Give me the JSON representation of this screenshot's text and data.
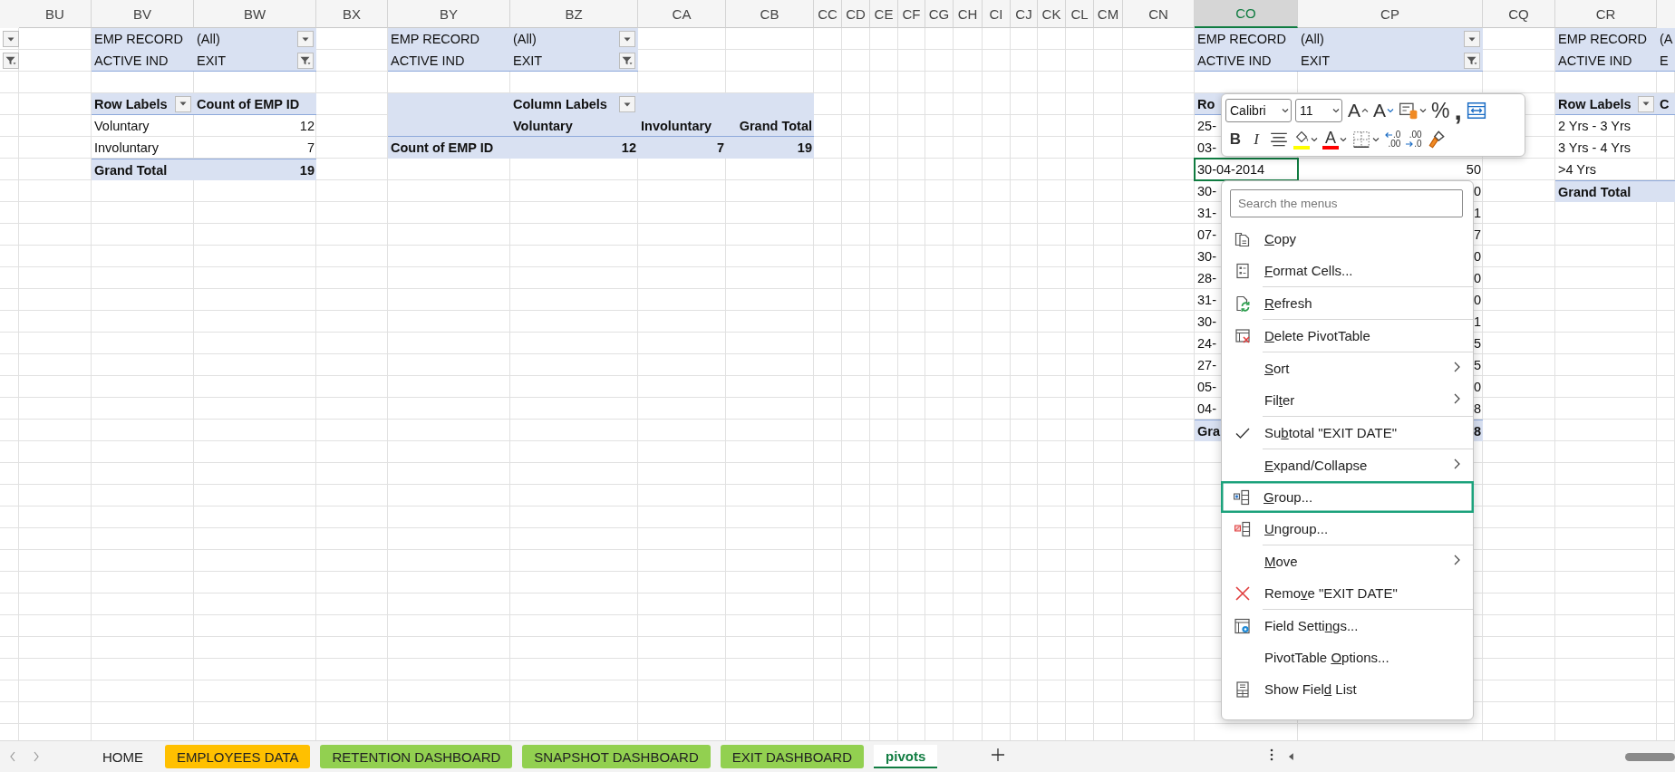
{
  "columns": [
    {
      "label": "BU",
      "selected": false
    },
    {
      "label": "BV",
      "selected": false
    },
    {
      "label": "BW",
      "selected": false
    },
    {
      "label": "BX",
      "selected": false
    },
    {
      "label": "BY",
      "selected": false
    },
    {
      "label": "BZ",
      "selected": false
    },
    {
      "label": "CA",
      "selected": false
    },
    {
      "label": "CB",
      "selected": false
    },
    {
      "label": "CC",
      "selected": false
    },
    {
      "label": "CD",
      "selected": false
    },
    {
      "label": "CE",
      "selected": false
    },
    {
      "label": "CF",
      "selected": false
    },
    {
      "label": "CG",
      "selected": false
    },
    {
      "label": "CH",
      "selected": false
    },
    {
      "label": "CI",
      "selected": false
    },
    {
      "label": "CJ",
      "selected": false
    },
    {
      "label": "CK",
      "selected": false
    },
    {
      "label": "CL",
      "selected": false
    },
    {
      "label": "CM",
      "selected": false
    },
    {
      "label": "CN",
      "selected": false
    },
    {
      "label": "CO",
      "selected": true
    },
    {
      "label": "CP",
      "selected": false
    },
    {
      "label": "CQ",
      "selected": false
    },
    {
      "label": "CR",
      "selected": false
    }
  ],
  "pivots": [
    {
      "kind": "stub",
      "filter_buttons": [
        {
          "filtered": false
        },
        {
          "filtered": true
        }
      ]
    },
    {
      "kind": "rows",
      "filters": [
        {
          "field": "EMP RECORD",
          "value": "(All)",
          "filtered": false
        },
        {
          "field": "ACTIVE IND",
          "value": "EXIT",
          "filtered": true
        }
      ],
      "header": [
        "Row Labels",
        "Count of EMP ID"
      ],
      "header_button": true,
      "rows": [
        {
          "cells": [
            "Voluntary",
            "12"
          ],
          "selected": false
        },
        {
          "cells": [
            "Involuntary",
            "7"
          ],
          "selected": false
        }
      ],
      "total": [
        "Grand Total",
        "19"
      ]
    },
    {
      "kind": "columns",
      "filters": [
        {
          "field": "EMP RECORD",
          "value": "(All)",
          "filtered": false
        },
        {
          "field": "ACTIVE IND",
          "value": "EXIT",
          "filtered": true
        }
      ],
      "column_labels": "Column Labels",
      "header_button": true,
      "columns": [
        "Voluntary",
        "Involuntary",
        "Grand Total"
      ],
      "rows": [
        {
          "label": "Count of EMP ID",
          "values": [
            "12",
            "7",
            "19"
          ],
          "selected": false
        }
      ]
    },
    {
      "kind": "rows",
      "filters": [
        {
          "field": "EMP RECORD",
          "value": "(All)",
          "filtered": false
        },
        {
          "field": "ACTIVE IND",
          "value": "EXIT",
          "filtered": true
        }
      ],
      "header": [
        "Ro"
      ],
      "header_button": false,
      "rows": [
        {
          "cells": [
            "25-"
          ],
          "selected": false
        },
        {
          "cells": [
            "03-"
          ],
          "selected": false
        },
        {
          "cells": [
            "30-04-2014",
            "50"
          ],
          "selected": true
        },
        {
          "cells": [
            "30-",
            "0"
          ],
          "selected": false
        },
        {
          "cells": [
            "31-",
            "1"
          ],
          "selected": false
        },
        {
          "cells": [
            "07-",
            "7"
          ],
          "selected": false
        },
        {
          "cells": [
            "30-",
            "0"
          ],
          "selected": false
        },
        {
          "cells": [
            "28-",
            "0"
          ],
          "selected": false
        },
        {
          "cells": [
            "31-",
            "0"
          ],
          "selected": false
        },
        {
          "cells": [
            "30-",
            "1"
          ],
          "selected": false
        },
        {
          "cells": [
            "24-",
            "5"
          ],
          "selected": false
        },
        {
          "cells": [
            "27-",
            "5"
          ],
          "selected": false
        },
        {
          "cells": [
            "05-",
            "0"
          ],
          "selected": false
        },
        {
          "cells": [
            "04-",
            "8"
          ],
          "selected": false
        }
      ],
      "total": [
        "Gra",
        "8"
      ]
    },
    {
      "kind": "rows",
      "filters": [
        {
          "field": "EMP RECORD",
          "value": "(A"
        },
        {
          "field": "ACTIVE IND",
          "value": "E"
        }
      ],
      "header": [
        "Row Labels",
        "C"
      ],
      "header_button": true,
      "rows": [
        {
          "cells": [
            "2 Yrs - 3 Yrs"
          ],
          "selected": false
        },
        {
          "cells": [
            "3 Yrs - 4 Yrs"
          ],
          "selected": false
        },
        {
          "cells": [
            ">4 Yrs"
          ],
          "selected": false
        }
      ],
      "total": [
        "Grand Total"
      ]
    }
  ],
  "mini_toolbar": {
    "font": "Calibri",
    "size": "11",
    "rows": [
      [
        {
          "kind": "grow-font",
          "label": "A"
        },
        {
          "kind": "shrink-font",
          "label": "A"
        },
        {
          "kind": "cell-styles",
          "caret": true
        },
        {
          "kind": "percent",
          "label": "%"
        },
        {
          "kind": "comma",
          "label": ","
        },
        {
          "kind": "wrap"
        }
      ],
      [
        {
          "kind": "bold",
          "label": "B"
        },
        {
          "kind": "italic",
          "label": "I"
        },
        {
          "kind": "align"
        },
        {
          "kind": "fill",
          "color": "#ffff00",
          "caret": true
        },
        {
          "kind": "font-color",
          "label": "A",
          "color": "#ff0000",
          "caret": true
        },
        {
          "kind": "borders",
          "caret": true
        },
        {
          "kind": "decrease-decimal",
          "lines": [
            ".0",
            ".00"
          ]
        },
        {
          "kind": "increase-decimal",
          "lines": [
            ".00",
            ".0"
          ]
        },
        {
          "kind": "painter"
        }
      ]
    ]
  },
  "context_menu": {
    "search": {
      "placeholder": "Search the menus"
    },
    "items": [
      {
        "key": "C",
        "after": "opy",
        "kind": "copy",
        "submenu": false,
        "separator_before": false,
        "checked": false,
        "selected": false
      },
      {
        "key": "F",
        "after": "ormat Cells...",
        "kind": "format",
        "submenu": false,
        "separator_before": false,
        "checked": false,
        "selected": false
      },
      {
        "key": "R",
        "after": "efresh",
        "kind": "refresh",
        "submenu": false,
        "separator_before": true,
        "checked": false,
        "selected": false
      },
      {
        "key": "D",
        "after": "elete PivotTable",
        "kind": "delete",
        "submenu": false,
        "separator_before": true,
        "checked": false,
        "selected": false
      },
      {
        "key": "S",
        "after": "ort",
        "submenu": true,
        "separator_before": true,
        "checked": false,
        "selected": false
      },
      {
        "before": "Fil",
        "key": "t",
        "after": "er",
        "submenu": true,
        "separator_before": false,
        "checked": false,
        "selected": false
      },
      {
        "before": "Su",
        "key": "b",
        "after": "total \"EXIT DATE\"",
        "submenu": false,
        "separator_before": true,
        "checked": true,
        "selected": false
      },
      {
        "key": "E",
        "after": "xpand/Collapse",
        "submenu": true,
        "separator_before": true,
        "checked": false,
        "selected": false
      },
      {
        "key": "G",
        "after": "roup...",
        "kind": "group",
        "submenu": false,
        "separator_before": false,
        "checked": false,
        "selected": true
      },
      {
        "key": "U",
        "after": "ngroup...",
        "kind": "ungroup",
        "submenu": false,
        "separator_before": false,
        "checked": false,
        "selected": false
      },
      {
        "key": "M",
        "after": "ove",
        "submenu": true,
        "separator_before": true,
        "checked": false,
        "selected": false
      },
      {
        "before": "Remo",
        "key": "v",
        "after": "e \"EXIT DATE\"",
        "kind": "remove",
        "submenu": false,
        "separator_before": false,
        "checked": false,
        "selected": false
      },
      {
        "before": "Field Setti",
        "key": "n",
        "after": "gs...",
        "kind": "settings",
        "submenu": false,
        "separator_before": true,
        "checked": false,
        "selected": false
      },
      {
        "before": "PivotTable ",
        "key": "O",
        "after": "ptions...",
        "submenu": false,
        "separator_before": false,
        "checked": false,
        "selected": false
      },
      {
        "before": "Show Fiel",
        "key": "d",
        "after": " List",
        "kind": "field-list",
        "submenu": false,
        "separator_before": false,
        "checked": false,
        "selected": false
      }
    ]
  },
  "sheet_tabs": [
    {
      "label": "HOME",
      "selected": false
    },
    {
      "label": "EMPLOYEES DATA",
      "color": "#ffc000",
      "selected": false
    },
    {
      "label": "RETENTION DASHBOARD",
      "color": "#92d050",
      "selected": false
    },
    {
      "label": "SNAPSHOT DASHBOARD",
      "color": "#92d050",
      "selected": false
    },
    {
      "label": "EXIT DASHBOARD",
      "color": "#92d050",
      "selected": false
    },
    {
      "label": "pivots",
      "selected": true
    }
  ]
}
